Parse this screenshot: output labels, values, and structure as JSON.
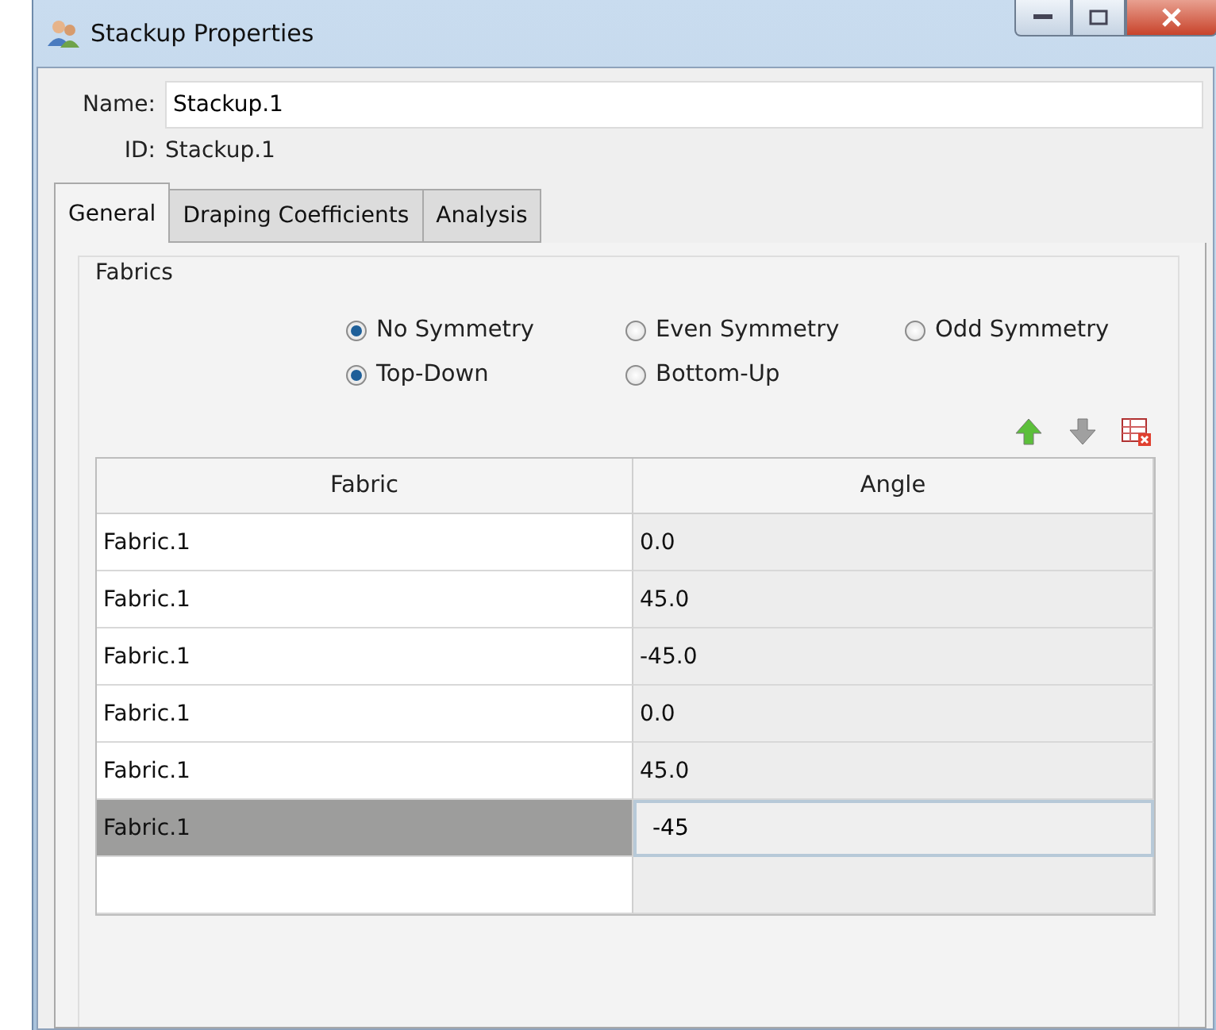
{
  "window": {
    "title": "Stackup Properties"
  },
  "name_field": {
    "label": "Name:",
    "value": "Stackup.1"
  },
  "id_row": {
    "label": "ID:",
    "value": "Stackup.1"
  },
  "tabs": [
    {
      "label": "General",
      "selected": true
    },
    {
      "label": "Draping Coefficients",
      "selected": false
    },
    {
      "label": "Analysis",
      "selected": false
    }
  ],
  "group": {
    "title": "Fabrics"
  },
  "symmetry": [
    {
      "label": "No Symmetry",
      "selected": true
    },
    {
      "label": "Even Symmetry",
      "selected": false
    },
    {
      "label": "Odd Symmetry",
      "selected": false
    }
  ],
  "order": [
    {
      "label": "Top-Down",
      "selected": true
    },
    {
      "label": "Bottom-Up",
      "selected": false
    }
  ],
  "table": {
    "columns": [
      "Fabric",
      "Angle"
    ],
    "rows": [
      {
        "fabric": "Fabric.1",
        "angle": "0.0",
        "selected": false
      },
      {
        "fabric": "Fabric.1",
        "angle": "45.0",
        "selected": false
      },
      {
        "fabric": "Fabric.1",
        "angle": "-45.0",
        "selected": false
      },
      {
        "fabric": "Fabric.1",
        "angle": "0.0",
        "selected": false
      },
      {
        "fabric": "Fabric.1",
        "angle": "45.0",
        "selected": false
      },
      {
        "fabric": "Fabric.1",
        "angle": "-45",
        "selected": true
      }
    ]
  }
}
